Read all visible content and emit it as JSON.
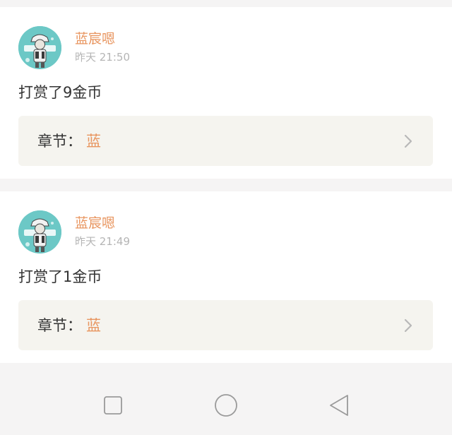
{
  "rewards": [
    {
      "username": "蓝宸嗯",
      "time": "昨天 21:50",
      "message": "打赏了9金币",
      "chapter_label": "章节：",
      "chapter_value": "蓝"
    },
    {
      "username": "蓝宸嗯",
      "time": "昨天 21:49",
      "message": "打赏了1金币",
      "chapter_label": "章节：",
      "chapter_value": "蓝"
    }
  ],
  "icons": {
    "avatar": "avatar-illustration",
    "chevron": "chevron-right-icon",
    "nav_recent": "square-icon",
    "nav_home": "circle-icon",
    "nav_back": "triangle-back-icon"
  },
  "colors": {
    "accent": "#e8955f",
    "text": "#333333",
    "muted": "#b5b5b5",
    "card": "#ffffff",
    "chapter_bg": "#f5f4ef",
    "page_bg": "#f5f4f4",
    "avatar_bg": "#6cc8c6"
  }
}
